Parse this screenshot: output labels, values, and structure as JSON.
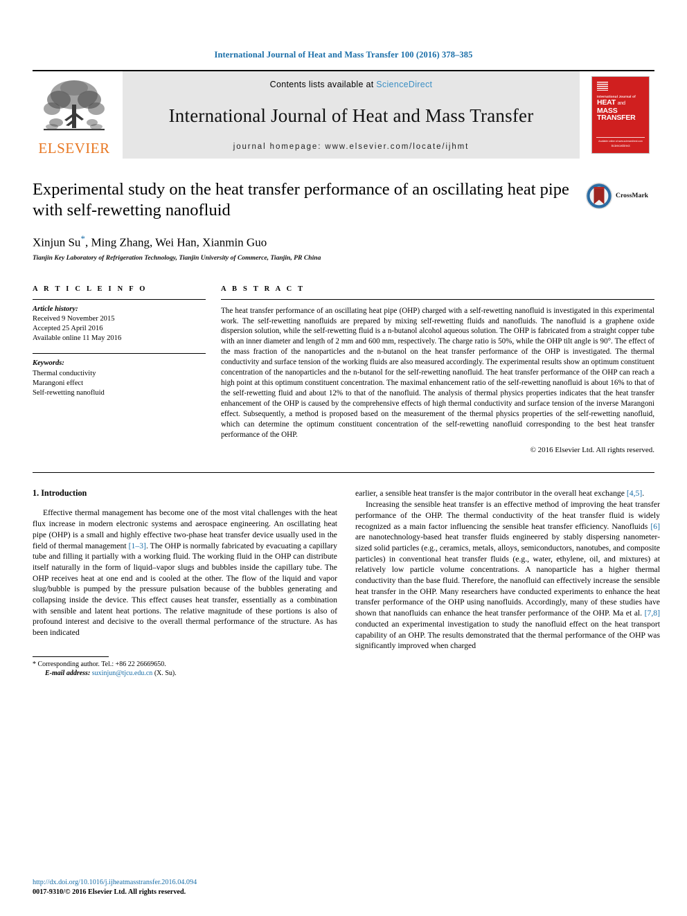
{
  "running_head": "International Journal of Heat and Mass Transfer 100 (2016) 378–385",
  "masthead": {
    "contents_prefix": "Contents lists available at ",
    "sciencedirect": "ScienceDirect",
    "journal_title": "International Journal of Heat and Mass Transfer",
    "homepage": "journal homepage: www.elsevier.com/locate/ijhmt",
    "publisher": "ELSEVIER",
    "cover": {
      "small_title": "International Journal of",
      "big_line1": "HEAT",
      "big_and": "and",
      "big_line2": "MASS",
      "big_line3": "TRANSFER",
      "footer_small": "Available online at www.sciencedirect.com",
      "footer_bold": "ScienceDirect"
    },
    "accent_blue": "#3b8fc4",
    "accent_orange": "#e87722",
    "cover_red": "#d01f1f"
  },
  "article": {
    "title": "Experimental study on the heat transfer performance of an oscillating heat pipe with self-rewetting nanofluid",
    "authors": "Xinjun Su",
    "authors_rest": ", Ming Zhang, Wei Han, Xianmin Guo",
    "corresponding_marker": "*",
    "affiliation": "Tianjin Key Laboratory of Refrigeration Technology, Tianjin University of Commerce, Tianjin, PR China",
    "crossmark_label": "CrossMark"
  },
  "article_info": {
    "heading": "A R T I C L E   I N F O",
    "history_label": "Article history:",
    "history": [
      "Received 9 November 2015",
      "Accepted 25 April 2016",
      "Available online 11 May 2016"
    ],
    "keywords_label": "Keywords:",
    "keywords": [
      "Thermal conductivity",
      "Marangoni effect",
      "Self-rewetting nanofluid"
    ]
  },
  "abstract": {
    "heading": "A B S T R A C T",
    "text": "The heat transfer performance of an oscillating heat pipe (OHP) charged with a self-rewetting nanofluid is investigated in this experimental work. The self-rewetting nanofluids are prepared by mixing self-rewetting fluids and nanofluids. The nanofluid is a graphene oxide dispersion solution, while the self-rewetting fluid is a n-butanol alcohol aqueous solution. The OHP is fabricated from a straight copper tube with an inner diameter and length of 2 mm and 600 mm, respectively. The charge ratio is 50%, while the OHP tilt angle is 90°. The effect of the mass fraction of the nanoparticles and the n-butanol on the heat transfer performance of the OHP is investigated. The thermal conductivity and surface tension of the working fluids are also measured accordingly. The experimental results show an optimum constituent concentration of the nanoparticles and the n-butanol for the self-rewetting nanofluid. The heat transfer performance of the OHP can reach a high point at this optimum constituent concentration. The maximal enhancement ratio of the self-rewetting nanofluid is about 16% to that of the self-rewetting fluid and about 12% to that of the nanofluid. The analysis of thermal physics properties indicates that the heat transfer enhancement of the OHP is caused by the comprehensive effects of high thermal conductivity and surface tension of the inverse Marangoni effect. Subsequently, a method is proposed based on the measurement of the thermal physics properties of the self-rewetting nanofluid, which can determine the optimum constituent concentration of the self-rewetting nanofluid corresponding to the best heat transfer performance of the OHP.",
    "copyright": "© 2016 Elsevier Ltd. All rights reserved."
  },
  "introduction": {
    "section_title": "1. Introduction",
    "left_p1_a": "Effective thermal management has become one of the most vital challenges with the heat flux increase in modern electronic systems and aerospace engineering. An oscillating heat pipe (OHP) is a small and highly effective two-phase heat transfer device usually used in the field of thermal management ",
    "left_ref1": "[1–3]",
    "left_p1_b": ". The OHP is normally fabricated by evacuating a capillary tube and filling it partially with a working fluid. The working fluid in the OHP can distribute itself naturally in the form of liquid–vapor slugs and bubbles inside the capillary tube. The OHP receives heat at one end and is cooled at the other. The flow of the liquid and vapor slug/bubble is pumped by the pressure pulsation because of the bubbles generating and collapsing inside the device. This effect causes heat transfer, essentially as a combination with sensible and latent heat portions. The relative magnitude of these portions is also of profound interest and decisive to the overall thermal performance of the structure. As has been indicated",
    "right_p0_a": "earlier, a sensible heat transfer is the major contributor in the overall heat exchange ",
    "right_ref0": "[4,5]",
    "right_p0_b": ".",
    "right_p1_a": "Increasing the sensible heat transfer is an effective method of improving the heat transfer performance of the OHP. The thermal conductivity of the heat transfer fluid is widely recognized as a main factor influencing the sensible heat transfer efficiency. Nanofluids ",
    "right_ref1": "[6]",
    "right_p1_b": " are nanotechnology-based heat transfer fluids engineered by stably dispersing nanometer-sized solid particles (e.g., ceramics, metals, alloys, semiconductors, nanotubes, and composite particles) in conventional heat transfer fluids (e.g., water, ethylene, oil, and mixtures) at relatively low particle volume concentrations. A nanoparticle has a higher thermal conductivity than the base fluid. Therefore, the nanofluid can effectively increase the sensible heat transfer in the OHP. Many researchers have conducted experiments to enhance the heat transfer performance of the OHP using nanofluids. Accordingly, many of these studies have shown that nanofluids can enhance the heat transfer performance of the OHP. Ma et al. ",
    "right_ref2": "[7,8]",
    "right_p1_c": " conducted an experimental investigation to study the nanofluid effect on the heat transport capability of an OHP. The results demonstrated that the thermal performance of the OHP was significantly improved when charged"
  },
  "footnote": {
    "marker": "*",
    "corresponding": "Corresponding author. Tel.: +86 22 26669650.",
    "email_label": "E-mail address:",
    "email": "suxinjun@tjcu.edu.cn",
    "email_suffix": "(X. Su)."
  },
  "page_footer": {
    "doi": "http://dx.doi.org/10.1016/j.ijheatmasstransfer.2016.04.094",
    "issn_line": "0017-9310/© 2016 Elsevier Ltd. All rights reserved."
  }
}
